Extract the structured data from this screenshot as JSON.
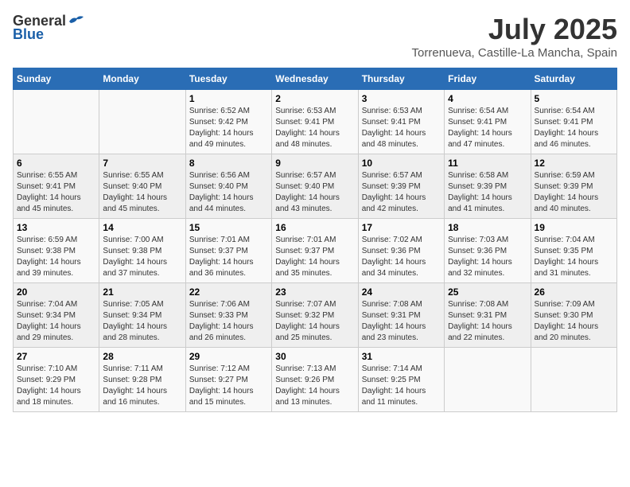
{
  "header": {
    "logo_general": "General",
    "logo_blue": "Blue",
    "month_year": "July 2025",
    "location": "Torrenueva, Castille-La Mancha, Spain"
  },
  "days_of_week": [
    "Sunday",
    "Monday",
    "Tuesday",
    "Wednesday",
    "Thursday",
    "Friday",
    "Saturday"
  ],
  "weeks": [
    [
      {
        "day": "",
        "sunrise": "",
        "sunset": "",
        "daylight": ""
      },
      {
        "day": "",
        "sunrise": "",
        "sunset": "",
        "daylight": ""
      },
      {
        "day": "1",
        "sunrise": "Sunrise: 6:52 AM",
        "sunset": "Sunset: 9:42 PM",
        "daylight": "Daylight: 14 hours and 49 minutes."
      },
      {
        "day": "2",
        "sunrise": "Sunrise: 6:53 AM",
        "sunset": "Sunset: 9:41 PM",
        "daylight": "Daylight: 14 hours and 48 minutes."
      },
      {
        "day": "3",
        "sunrise": "Sunrise: 6:53 AM",
        "sunset": "Sunset: 9:41 PM",
        "daylight": "Daylight: 14 hours and 48 minutes."
      },
      {
        "day": "4",
        "sunrise": "Sunrise: 6:54 AM",
        "sunset": "Sunset: 9:41 PM",
        "daylight": "Daylight: 14 hours and 47 minutes."
      },
      {
        "day": "5",
        "sunrise": "Sunrise: 6:54 AM",
        "sunset": "Sunset: 9:41 PM",
        "daylight": "Daylight: 14 hours and 46 minutes."
      }
    ],
    [
      {
        "day": "6",
        "sunrise": "Sunrise: 6:55 AM",
        "sunset": "Sunset: 9:41 PM",
        "daylight": "Daylight: 14 hours and 45 minutes."
      },
      {
        "day": "7",
        "sunrise": "Sunrise: 6:55 AM",
        "sunset": "Sunset: 9:40 PM",
        "daylight": "Daylight: 14 hours and 45 minutes."
      },
      {
        "day": "8",
        "sunrise": "Sunrise: 6:56 AM",
        "sunset": "Sunset: 9:40 PM",
        "daylight": "Daylight: 14 hours and 44 minutes."
      },
      {
        "day": "9",
        "sunrise": "Sunrise: 6:57 AM",
        "sunset": "Sunset: 9:40 PM",
        "daylight": "Daylight: 14 hours and 43 minutes."
      },
      {
        "day": "10",
        "sunrise": "Sunrise: 6:57 AM",
        "sunset": "Sunset: 9:39 PM",
        "daylight": "Daylight: 14 hours and 42 minutes."
      },
      {
        "day": "11",
        "sunrise": "Sunrise: 6:58 AM",
        "sunset": "Sunset: 9:39 PM",
        "daylight": "Daylight: 14 hours and 41 minutes."
      },
      {
        "day": "12",
        "sunrise": "Sunrise: 6:59 AM",
        "sunset": "Sunset: 9:39 PM",
        "daylight": "Daylight: 14 hours and 40 minutes."
      }
    ],
    [
      {
        "day": "13",
        "sunrise": "Sunrise: 6:59 AM",
        "sunset": "Sunset: 9:38 PM",
        "daylight": "Daylight: 14 hours and 39 minutes."
      },
      {
        "day": "14",
        "sunrise": "Sunrise: 7:00 AM",
        "sunset": "Sunset: 9:38 PM",
        "daylight": "Daylight: 14 hours and 37 minutes."
      },
      {
        "day": "15",
        "sunrise": "Sunrise: 7:01 AM",
        "sunset": "Sunset: 9:37 PM",
        "daylight": "Daylight: 14 hours and 36 minutes."
      },
      {
        "day": "16",
        "sunrise": "Sunrise: 7:01 AM",
        "sunset": "Sunset: 9:37 PM",
        "daylight": "Daylight: 14 hours and 35 minutes."
      },
      {
        "day": "17",
        "sunrise": "Sunrise: 7:02 AM",
        "sunset": "Sunset: 9:36 PM",
        "daylight": "Daylight: 14 hours and 34 minutes."
      },
      {
        "day": "18",
        "sunrise": "Sunrise: 7:03 AM",
        "sunset": "Sunset: 9:36 PM",
        "daylight": "Daylight: 14 hours and 32 minutes."
      },
      {
        "day": "19",
        "sunrise": "Sunrise: 7:04 AM",
        "sunset": "Sunset: 9:35 PM",
        "daylight": "Daylight: 14 hours and 31 minutes."
      }
    ],
    [
      {
        "day": "20",
        "sunrise": "Sunrise: 7:04 AM",
        "sunset": "Sunset: 9:34 PM",
        "daylight": "Daylight: 14 hours and 29 minutes."
      },
      {
        "day": "21",
        "sunrise": "Sunrise: 7:05 AM",
        "sunset": "Sunset: 9:34 PM",
        "daylight": "Daylight: 14 hours and 28 minutes."
      },
      {
        "day": "22",
        "sunrise": "Sunrise: 7:06 AM",
        "sunset": "Sunset: 9:33 PM",
        "daylight": "Daylight: 14 hours and 26 minutes."
      },
      {
        "day": "23",
        "sunrise": "Sunrise: 7:07 AM",
        "sunset": "Sunset: 9:32 PM",
        "daylight": "Daylight: 14 hours and 25 minutes."
      },
      {
        "day": "24",
        "sunrise": "Sunrise: 7:08 AM",
        "sunset": "Sunset: 9:31 PM",
        "daylight": "Daylight: 14 hours and 23 minutes."
      },
      {
        "day": "25",
        "sunrise": "Sunrise: 7:08 AM",
        "sunset": "Sunset: 9:31 PM",
        "daylight": "Daylight: 14 hours and 22 minutes."
      },
      {
        "day": "26",
        "sunrise": "Sunrise: 7:09 AM",
        "sunset": "Sunset: 9:30 PM",
        "daylight": "Daylight: 14 hours and 20 minutes."
      }
    ],
    [
      {
        "day": "27",
        "sunrise": "Sunrise: 7:10 AM",
        "sunset": "Sunset: 9:29 PM",
        "daylight": "Daylight: 14 hours and 18 minutes."
      },
      {
        "day": "28",
        "sunrise": "Sunrise: 7:11 AM",
        "sunset": "Sunset: 9:28 PM",
        "daylight": "Daylight: 14 hours and 16 minutes."
      },
      {
        "day": "29",
        "sunrise": "Sunrise: 7:12 AM",
        "sunset": "Sunset: 9:27 PM",
        "daylight": "Daylight: 14 hours and 15 minutes."
      },
      {
        "day": "30",
        "sunrise": "Sunrise: 7:13 AM",
        "sunset": "Sunset: 9:26 PM",
        "daylight": "Daylight: 14 hours and 13 minutes."
      },
      {
        "day": "31",
        "sunrise": "Sunrise: 7:14 AM",
        "sunset": "Sunset: 9:25 PM",
        "daylight": "Daylight: 14 hours and 11 minutes."
      },
      {
        "day": "",
        "sunrise": "",
        "sunset": "",
        "daylight": ""
      },
      {
        "day": "",
        "sunrise": "",
        "sunset": "",
        "daylight": ""
      }
    ]
  ]
}
